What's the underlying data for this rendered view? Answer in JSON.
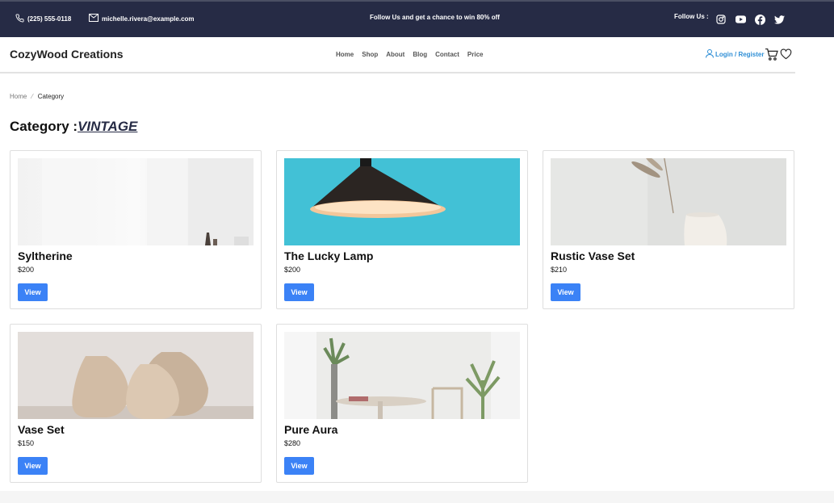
{
  "topbar": {
    "phone": "(225) 555-0118",
    "email": "michelle.rivera@example.com",
    "promo": "Follow Us and get a chance to win 80% off",
    "follow_label": "Follow Us :",
    "socials": [
      "instagram-icon",
      "youtube-icon",
      "facebook-icon",
      "twitter-icon"
    ]
  },
  "header": {
    "brand": "CozyWood Creations",
    "nav": [
      "Home",
      "Shop",
      "About",
      "Blog",
      "Contact",
      "Price"
    ],
    "login_label": "Login / Register"
  },
  "breadcrumb": {
    "home": "Home",
    "current": "Category"
  },
  "page": {
    "title_prefix": "Category :",
    "category": "VINTAGE"
  },
  "products": [
    {
      "name": "Syltherine",
      "price": "$200",
      "button": "View"
    },
    {
      "name": "The Lucky Lamp",
      "price": "$200",
      "button": "View"
    },
    {
      "name": "Rustic Vase Set",
      "price": "$210",
      "button": "View"
    },
    {
      "name": "Vase Set",
      "price": "$150",
      "button": "View"
    },
    {
      "name": "Pure Aura",
      "price": "$280",
      "button": "View"
    }
  ],
  "colors": {
    "topbar": "#262b45",
    "accent": "#3b82f6",
    "link": "#2f8fd6"
  }
}
